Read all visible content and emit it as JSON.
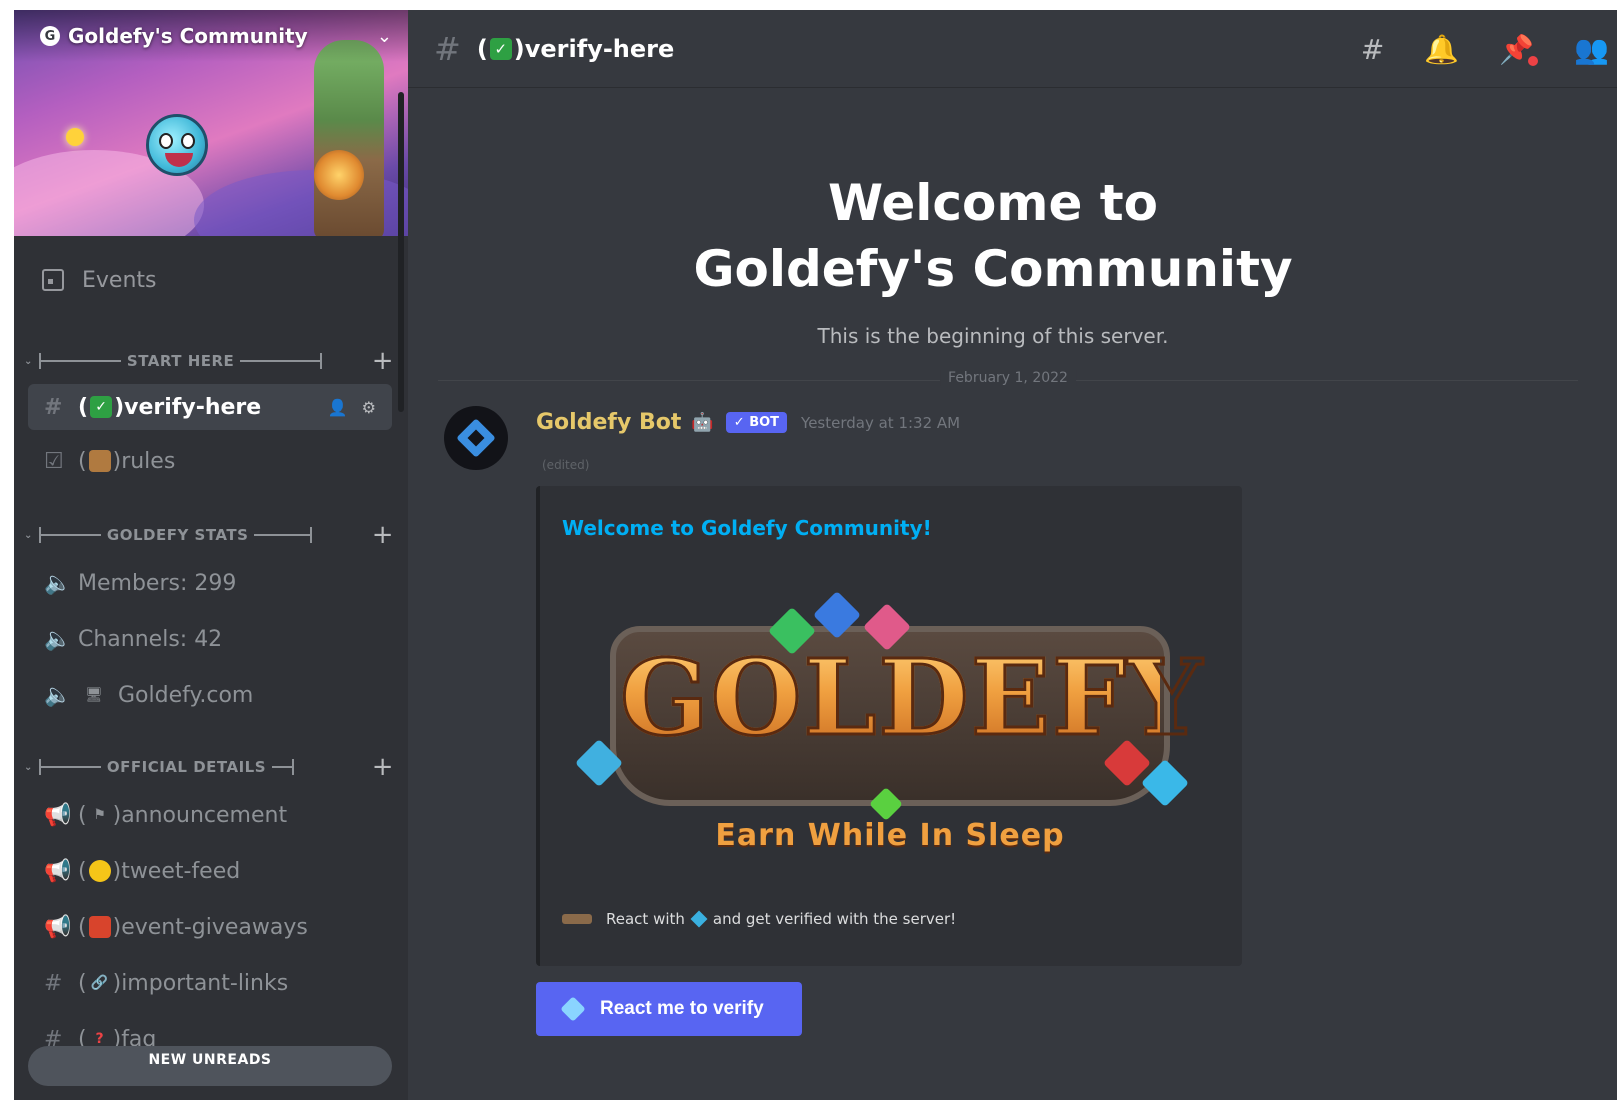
{
  "server": {
    "name": "Goldefy's Community",
    "badge": "G"
  },
  "sidebar": {
    "events_label": "Events",
    "categories": [
      {
        "label": "START HERE"
      },
      {
        "label": "GOLDEFY STATS"
      },
      {
        "label": "OFFICIAL DETAILS"
      }
    ],
    "channels": {
      "verify": "verify-here",
      "rules": "rules",
      "members": "Members: 299",
      "channels_count": "Channels: 42",
      "website": "Goldefy.com",
      "announcement": "announcement",
      "tweet": "tweet-feed",
      "giveaways": "event-giveaways",
      "links": "important-links",
      "faq": "faq"
    },
    "new_unreads": "NEW UNREADS"
  },
  "header": {
    "channel_name": "verify-here"
  },
  "welcome": {
    "line1": "Welcome to",
    "line2": "Goldefy's Community",
    "subtitle": "This is the beginning of this server."
  },
  "divider_date": "February 1, 2022",
  "message": {
    "author": "Goldefy Bot",
    "bot_badge": "✓ BOT",
    "timestamp": "Yesterday at 1:32 AM",
    "edited": "(edited)",
    "embed_title": "Welcome to Goldefy Community!",
    "logo_word": "GOLDEFY",
    "logo_tagline": "Earn While In Sleep",
    "footer_pre": "React with",
    "footer_post": "and get verified with the server!",
    "button_label": "React me to verify"
  },
  "colors": {
    "accent": "#5865f2",
    "author": "#e6c86a",
    "link": "#00aff4"
  }
}
